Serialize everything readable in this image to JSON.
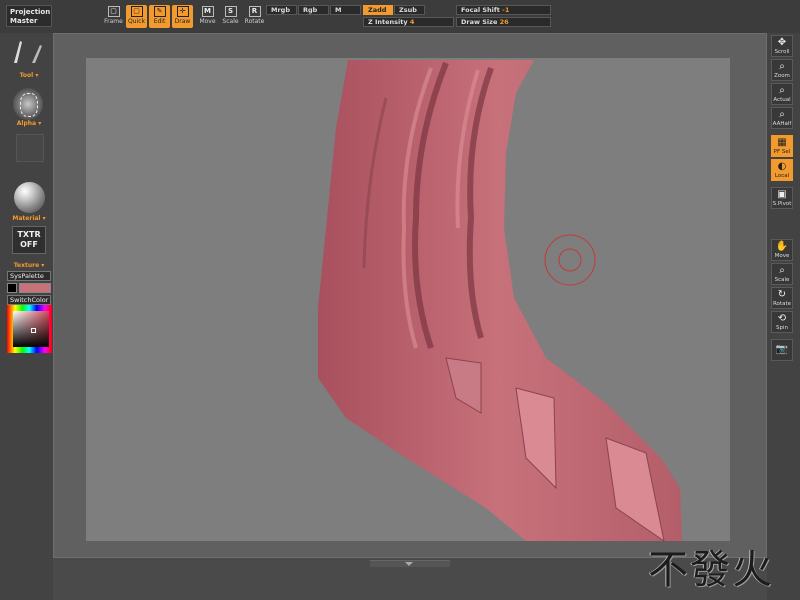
{
  "topbar": {
    "projection_master": "Projection Master",
    "buttons": {
      "frame": "Frame",
      "quick": "Quick",
      "edit": "Edit",
      "draw": "Draw",
      "move": "Move",
      "scale": "Scale",
      "rotate": "Rotate"
    },
    "mrgb": "Mrgb",
    "rgb": "Rgb",
    "m": "M",
    "zadd": "Zadd",
    "zsub": "Zsub",
    "focal_shift_label": "Focal Shift",
    "focal_shift_value": "-1",
    "z_intensity_label": "Z Intensity",
    "z_intensity_value": "4",
    "draw_size_label": "Draw Size",
    "draw_size_value": "26"
  },
  "leftshelf": {
    "tool_label": "Tool",
    "alpha_label": "Alpha",
    "material_label": "Material",
    "texture_button": "TXTR OFF",
    "texture_label": "Texture",
    "syspalette": "SysPalette",
    "switchcolor": "SwitchColor",
    "main_color": "#c7717b"
  },
  "rightshelf": {
    "scroll": "Scroll",
    "zoom": "Zoom",
    "actual": "Actual",
    "aahalf": "AAHalf",
    "pf_sel": "PF Sel",
    "local": "Local",
    "s_pivot": "S.Pivot",
    "move": "Move",
    "scale": "Scale",
    "rotate": "Rotate",
    "spin": "Spin"
  },
  "canvas": {
    "mesh_color": "#c7717b",
    "background": "#7e7e7e"
  },
  "watermark": "不發火"
}
